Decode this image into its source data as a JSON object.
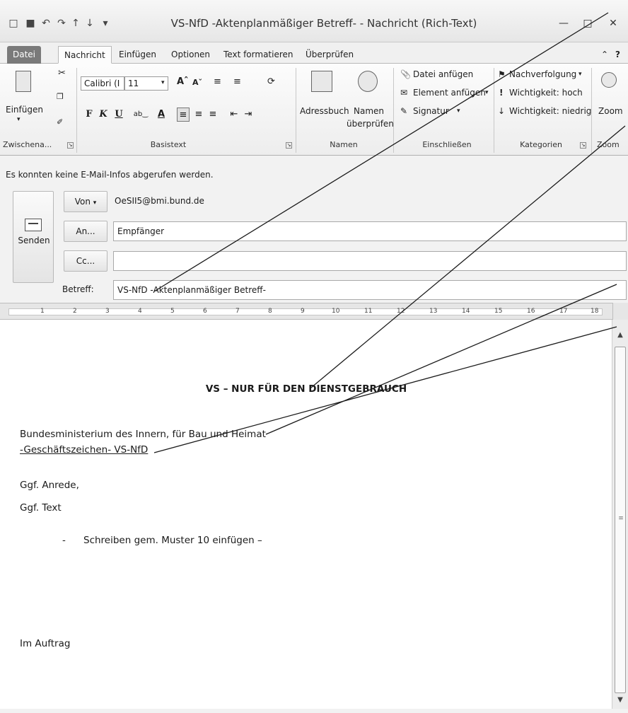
{
  "window": {
    "title": "VS-NfD -Aktenplanmäßiger Betreff- - Nachricht (Rich-Text)"
  },
  "tabs": [
    "Datei",
    "Nachricht",
    "Einfügen",
    "Optionen",
    "Text formatieren",
    "Überprüfen"
  ],
  "ribbon": {
    "clipboard": {
      "paste": "Einfügen",
      "group": "Zwischena..."
    },
    "basic_text": {
      "font": "Calibri (I",
      "size": "11",
      "bold": "F",
      "italic": "K",
      "underline": "U",
      "group": "Basistext"
    },
    "names": {
      "address_book": "Adressbuch",
      "check_names_1": "Namen",
      "check_names_2": "überprüfen",
      "group": "Namen"
    },
    "include": {
      "attach_file": "Datei anfügen",
      "attach_item": "Element anfügen",
      "signature": "Signatur",
      "group": "Einschließen"
    },
    "tags": {
      "follow_up": "Nachverfolgung",
      "high": "Wichtigkeit: hoch",
      "low": "Wichtigkeit: niedrig",
      "group": "Kategorien"
    },
    "zoom": {
      "label": "Zoom",
      "group": "Zoom"
    }
  },
  "compose": {
    "info": "Es konnten keine E-Mail-Infos abgerufen werden.",
    "send": "Senden",
    "from_button": "Von",
    "from_value": "OeSII5@bmi.bund.de",
    "to_button": "An...",
    "to_value": "Empfänger",
    "cc_button": "Cc...",
    "cc_value": "",
    "subject_label": "Betreff:",
    "subject_value": "VS-NfD -Aktenplanmäßiger Betreff-"
  },
  "ruler": [
    "1",
    "2",
    "3",
    "4",
    "5",
    "6",
    "7",
    "8",
    "9",
    "10",
    "11",
    "12",
    "13",
    "14",
    "15",
    "16",
    "17",
    "18"
  ],
  "body": {
    "heading": "VS – NUR FÜR DEN DIENSTGEBRAUCH",
    "line1": "Bundesministerium des Innern, für Bau und Heimat",
    "line2": "-Geschäftszeichen-  VS-NfD",
    "line3": "Ggf. Anrede,",
    "line4": "Ggf. Text",
    "bullet": "-",
    "line5": "Schreiben gem.  Muster 10 einfügen –",
    "closing": "Im Auftrag"
  },
  "colors": {
    "file_tab": "#7a7a7a",
    "callout_line": "#1a1a1a"
  }
}
